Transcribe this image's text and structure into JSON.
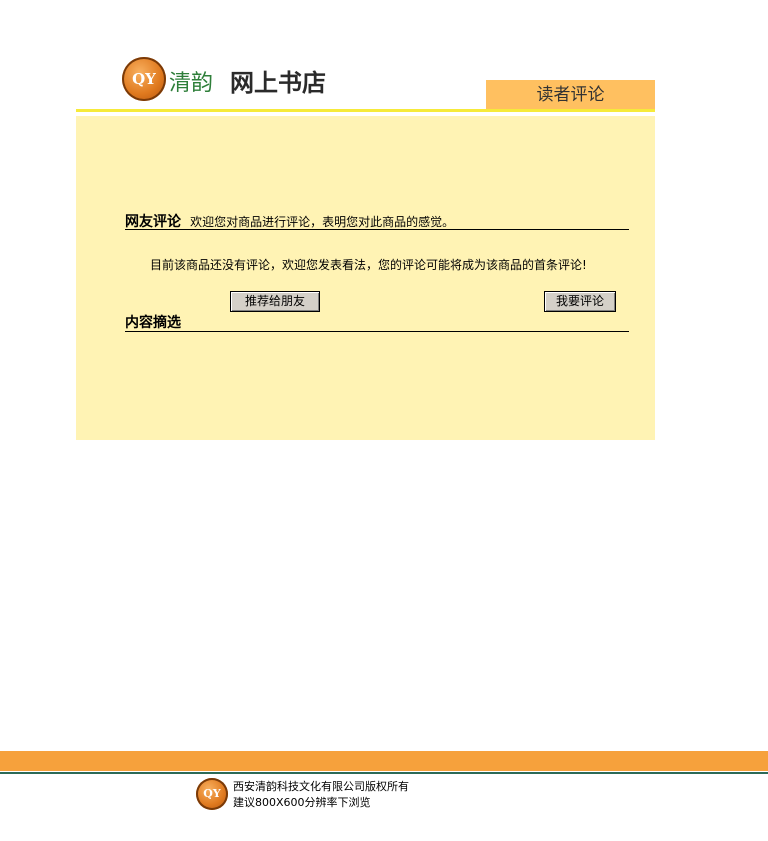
{
  "header": {
    "logo_text": "QY",
    "brand_name": "清韵",
    "store_name": "网上书店",
    "section_title": "读者评论"
  },
  "reviews": {
    "title": "网友评论",
    "description": "欢迎您对商品进行评论，表明您对此商品的感觉。",
    "empty_message": "目前该商品还没有评论，欢迎您发表看法，您的评论可能将成为该商品的首条评论!",
    "recommend_button": "推荐给朋友",
    "write_review_button": "我要评论"
  },
  "excerpts": {
    "title": "内容摘选"
  },
  "footer": {
    "logo_text": "QY",
    "copyright": "西安清韵科技文化有限公司版权所有",
    "resolution_hint": "建议800X600分辨率下浏览"
  },
  "colors": {
    "panel_bg": "#fff3b4",
    "tab_bg": "#ffc060",
    "accent_yellow": "#f6ea3a",
    "footer_orange": "#f6a13c",
    "footer_green": "#2b6a57"
  }
}
